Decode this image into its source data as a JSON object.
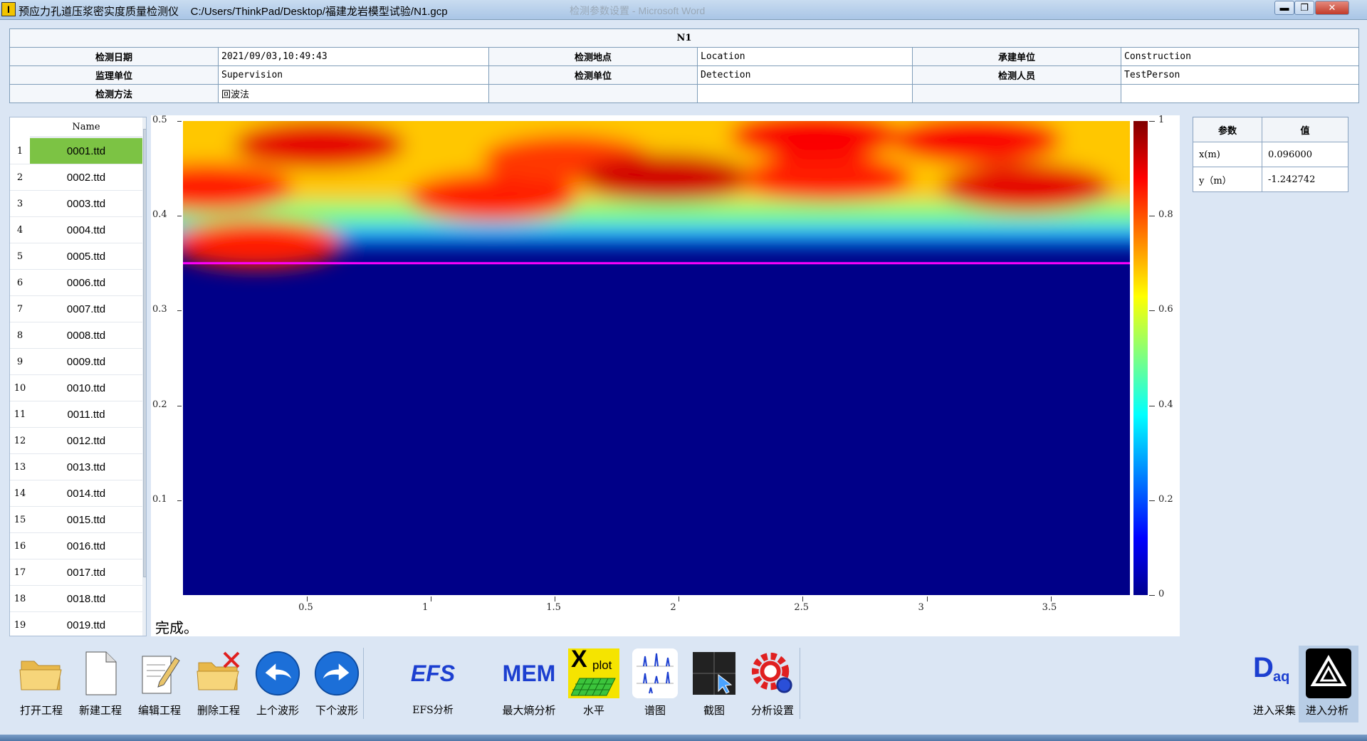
{
  "window": {
    "title": "预应力孔道压浆密实度质量检测仪    C:/Users/ThinkPad/Desktop/福建龙岩模型试验/N1.gcp",
    "background_title": "检测参数设置  -  Microsoft Word",
    "icon": "app-logo-icon",
    "min_label": "▬",
    "max_label": "❐",
    "close_label": "✕"
  },
  "info": {
    "header": "N1",
    "rows": [
      [
        {
          "label": "检测日期",
          "value": "2021/09/03,10:49:43"
        },
        {
          "label": "检测地点",
          "value": "Location"
        },
        {
          "label": "承建单位",
          "value": "Construction"
        }
      ],
      [
        {
          "label": "监理单位",
          "value": "Supervision"
        },
        {
          "label": "检测单位",
          "value": "Detection"
        },
        {
          "label": "检测人员",
          "value": "TestPerson"
        }
      ],
      [
        {
          "label": "检测方法",
          "value": "回波法"
        },
        {
          "label": "",
          "value": ""
        },
        {
          "label": "",
          "value": ""
        }
      ]
    ]
  },
  "file_list": {
    "header": "Name",
    "selected_index": 0,
    "items": [
      "0001.ttd",
      "0002.ttd",
      "0003.ttd",
      "0004.ttd",
      "0005.ttd",
      "0006.ttd",
      "0007.ttd",
      "0008.ttd",
      "0009.ttd",
      "0010.ttd",
      "0011.ttd",
      "0012.ttd",
      "0013.ttd",
      "0014.ttd",
      "0015.ttd",
      "0016.ttd",
      "0017.ttd",
      "0018.ttd",
      "0019.ttd"
    ],
    "numbers": [
      "1",
      "2",
      "3",
      "4",
      "5",
      "6",
      "7",
      "8",
      "9",
      "10",
      "11",
      "12",
      "13",
      "14",
      "15",
      "16",
      "17",
      "18",
      "19"
    ]
  },
  "chart_data": {
    "type": "heatmap",
    "xlim": [
      0.0,
      3.82
    ],
    "ylim": [
      0.0,
      0.5
    ],
    "x_ticks": [
      "0.5",
      "1",
      "1.5",
      "2",
      "2.5",
      "3",
      "3.5"
    ],
    "x_tick_values": [
      0.5,
      1.0,
      1.5,
      2.0,
      2.5,
      3.0,
      3.5
    ],
    "y_ticks": [
      "0.5",
      "0.4",
      "0.3",
      "0.2",
      "0.1"
    ],
    "y_tick_values": [
      0.5,
      0.4,
      0.3,
      0.2,
      0.1
    ],
    "colorbar_ticks": [
      "1",
      "0.8",
      "0.6",
      "0.4",
      "0.2",
      "0"
    ],
    "colorbar_values": [
      1.0,
      0.8,
      0.6,
      0.4,
      0.2,
      0.0
    ],
    "colormap": "jet",
    "marker_line": {
      "y": 0.35,
      "color": "#ff00ff"
    },
    "hotspots": [
      {
        "x": 0.1,
        "y": 0.43,
        "value": 0.85
      },
      {
        "x": 0.3,
        "y": 0.37,
        "value": 0.85
      },
      {
        "x": 0.55,
        "y": 0.475,
        "value": 0.9
      },
      {
        "x": 1.25,
        "y": 0.42,
        "value": 0.85
      },
      {
        "x": 1.55,
        "y": 0.46,
        "value": 0.82
      },
      {
        "x": 1.95,
        "y": 0.44,
        "value": 0.92
      },
      {
        "x": 2.6,
        "y": 0.44,
        "value": 0.85
      },
      {
        "x": 2.55,
        "y": 0.485,
        "value": 0.88
      },
      {
        "x": 3.2,
        "y": 0.48,
        "value": 0.88
      },
      {
        "x": 3.4,
        "y": 0.43,
        "value": 0.9
      }
    ]
  },
  "status": "完成。",
  "params": {
    "headers": [
      "参数",
      "值"
    ],
    "rows": [
      [
        "x(m)",
        "0.096000"
      ],
      [
        "y（m）",
        "-1.242742"
      ]
    ]
  },
  "toolbar": {
    "buttons": [
      {
        "name": "open-project-button",
        "label": "打开工程",
        "icon": "open-folder-icon"
      },
      {
        "name": "new-project-button",
        "label": "新建工程",
        "icon": "new-file-icon"
      },
      {
        "name": "edit-project-button",
        "label": "编辑工程",
        "icon": "edit-document-icon"
      },
      {
        "name": "delete-project-button",
        "label": "删除工程",
        "icon": "delete-folder-icon"
      },
      {
        "name": "prev-waveform-button",
        "label": "上个波形",
        "icon": "arrow-back-icon"
      },
      {
        "name": "next-waveform-button",
        "label": "下个波形",
        "icon": "arrow-forward-icon"
      },
      {
        "name": "efs-analysis-button",
        "label": "EFS分析",
        "icon": "efs-icon",
        "icon_text": "EFS"
      },
      {
        "name": "mem-analysis-button",
        "label": "最大熵分析",
        "icon": "mem-icon",
        "icon_text": "MEM"
      },
      {
        "name": "horizontal-button",
        "label": "水平",
        "icon": "xplot-icon",
        "icon_text": "X",
        "icon_subtext": "plot"
      },
      {
        "name": "spectrum-button",
        "label": "谱图",
        "icon": "spectrum-icon"
      },
      {
        "name": "screenshot-button",
        "label": "截图",
        "icon": "screenshot-icon"
      },
      {
        "name": "analysis-settings-button",
        "label": "分析设置",
        "icon": "settings-gear-icon"
      },
      {
        "name": "enter-acquisition-button",
        "label": "进入采集",
        "icon": "daq-icon",
        "icon_text": "D",
        "icon_subtext": "aq"
      },
      {
        "name": "enter-analysis-button",
        "label": "进入分析",
        "icon": "analysis-logo-icon"
      }
    ]
  },
  "colors": {
    "selected_row": "#7cc344",
    "marker_line": "#ff00ff",
    "background": "#dbe6f4"
  }
}
